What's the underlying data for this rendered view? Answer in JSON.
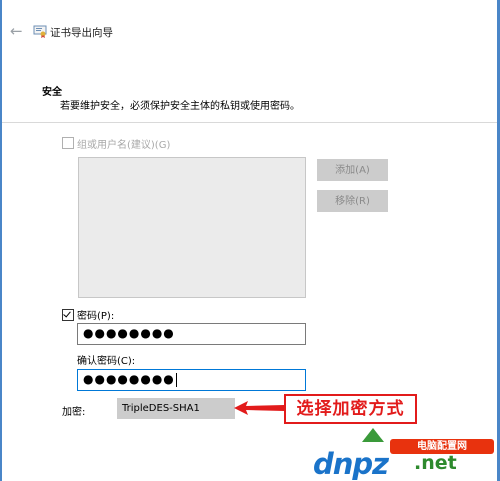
{
  "window": {
    "title": "证书导出向导",
    "back_icon": "back-arrow-icon",
    "app_icon": "certificate-icon"
  },
  "header": {
    "title": "安全",
    "description": "若要维护安全，必须保护安全主体的私钥或使用密码。"
  },
  "group_option": {
    "label": "组或用户名(建议)(G)",
    "checked": false,
    "enabled": false
  },
  "buttons": {
    "add": "添加(A)",
    "remove": "移除(R)"
  },
  "password": {
    "label": "密码(P):",
    "checked": true,
    "value": "●●●●●●●●"
  },
  "confirm": {
    "label": "确认密码(C):",
    "value": "●●●●●●●●"
  },
  "encryption": {
    "label": "加密:",
    "selected": "TripleDES-SHA1"
  },
  "annotation": {
    "text": "选择加密方式",
    "color": "#e21b1b"
  },
  "watermark": {
    "site": "电脑配置网",
    "logo_main": "dnpz",
    "logo_tld": ".net"
  },
  "colors": {
    "frame": "#4a86c8",
    "focus": "#0078d7",
    "disabled_button": "#cccccc"
  }
}
